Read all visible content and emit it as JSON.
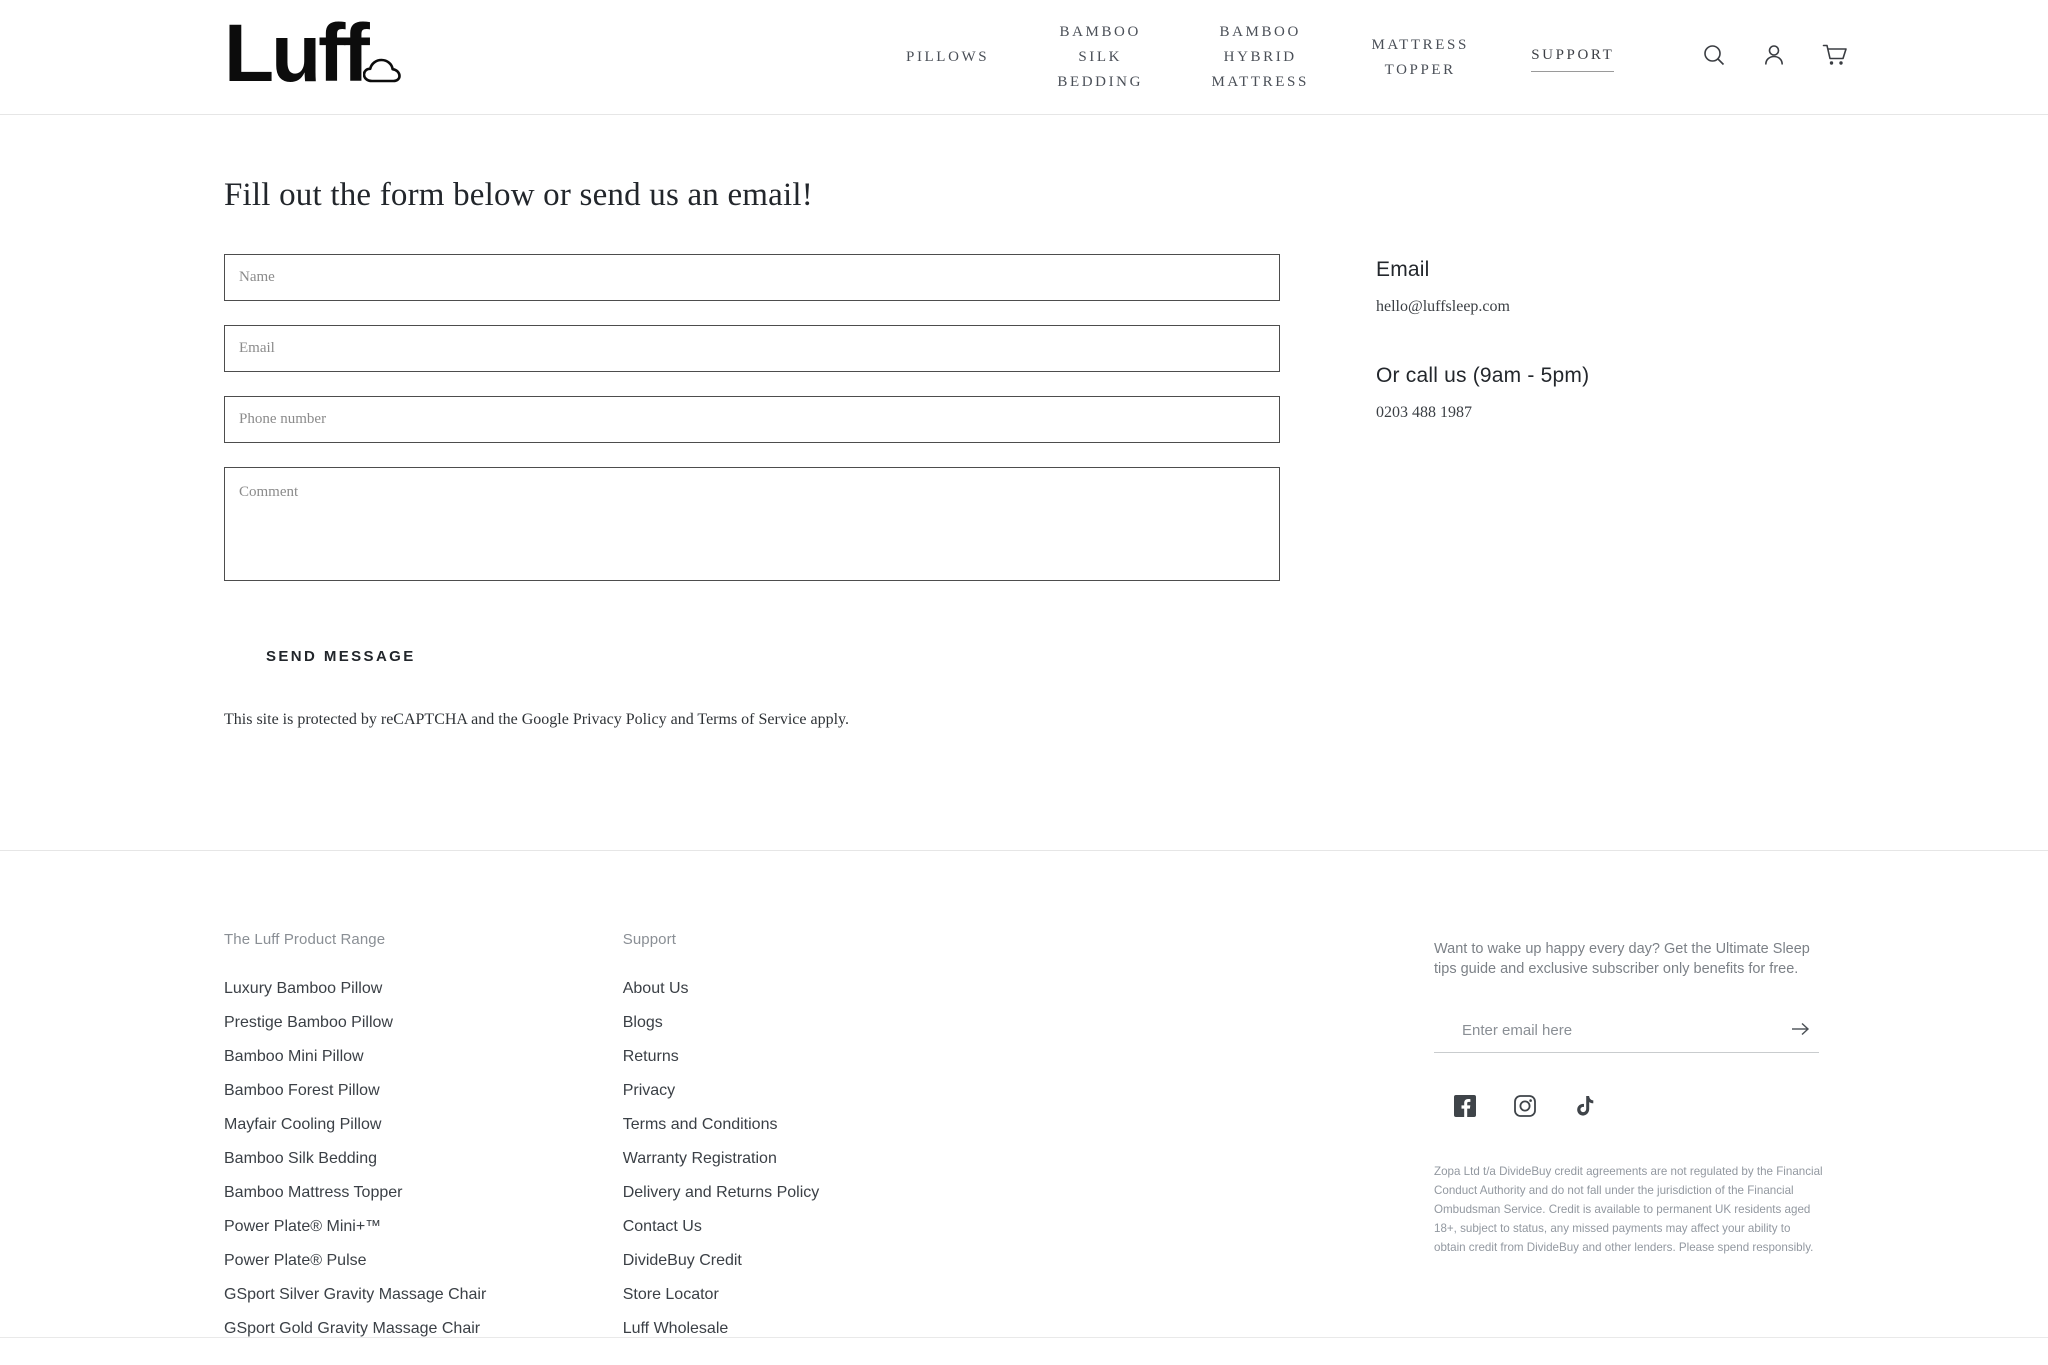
{
  "header": {
    "logo_text": "Luff",
    "logo_icon": "cloud-icon",
    "nav": [
      {
        "label": "PILLOWS",
        "active": false
      },
      {
        "label": "BAMBOO SILK BEDDING",
        "active": false
      },
      {
        "label": "BAMBOO HYBRID MATTRESS",
        "active": false
      },
      {
        "label": "MATTRESS TOPPER",
        "active": false
      },
      {
        "label": "SUPPORT",
        "active": true
      }
    ],
    "icons": {
      "search": "search-icon",
      "account": "user-icon",
      "cart": "cart-icon"
    }
  },
  "main": {
    "heading": "Fill out the form below or send us an email!",
    "form": {
      "name_placeholder": "Name",
      "name_value": "",
      "email_placeholder": "Email",
      "email_value": "",
      "phone_placeholder": "Phone number",
      "phone_value": "",
      "comment_placeholder": "Comment",
      "comment_value": "",
      "submit_label": "SEND MESSAGE"
    },
    "recaptcha_note": "This site is protected by reCAPTCHA and the Google Privacy Policy and Terms of Service apply.",
    "info": {
      "email_title": "Email",
      "email_value": "hello@luffsleep.com",
      "phone_title": "Or call us (9am - 5pm)",
      "phone_value": "0203 488 1987"
    }
  },
  "footer": {
    "products": {
      "title": "The Luff Product Range",
      "links": [
        "Luxury Bamboo Pillow",
        "Prestige Bamboo Pillow",
        "Bamboo Mini Pillow",
        "Bamboo Forest Pillow",
        "Mayfair Cooling Pillow",
        "Bamboo Silk Bedding",
        "Bamboo Mattress Topper",
        "Power Plate® Mini+™",
        "Power Plate® Pulse",
        "GSport Silver Gravity Massage Chair",
        "GSport Gold Gravity Massage Chair"
      ]
    },
    "support": {
      "title": "Support",
      "links": [
        "About Us",
        "Blogs",
        "Returns",
        "Privacy",
        "Terms and Conditions",
        "Warranty Registration",
        "Delivery and Returns Policy",
        "Contact Us",
        "DivideBuy Credit",
        "Store Locator",
        "Luff Wholesale"
      ]
    },
    "newsletter": {
      "text": "Want to wake up happy every day? Get the Ultimate Sleep tips guide and exclusive subscriber only benefits for free.",
      "placeholder": "Enter email here",
      "value": "",
      "submit_icon": "arrow-right-icon"
    },
    "socials": [
      {
        "name": "facebook-icon"
      },
      {
        "name": "instagram-icon"
      },
      {
        "name": "tiktok-icon"
      }
    ],
    "legal": "Zopa Ltd t/a DivideBuy credit agreements are not regulated by the Financial Conduct Authority and do not fall under the jurisdiction of the Financial Ombudsman Service. Credit is available to permanent UK residents aged 18+, subject to status, any missed payments may affect your ability to obtain credit from DivideBuy and other lenders. Please spend responsibly."
  },
  "colors": {
    "text": "#2b2f33",
    "muted": "#8a8f95",
    "border": "#e6e6e6",
    "field_border": "#4d4d4d"
  }
}
